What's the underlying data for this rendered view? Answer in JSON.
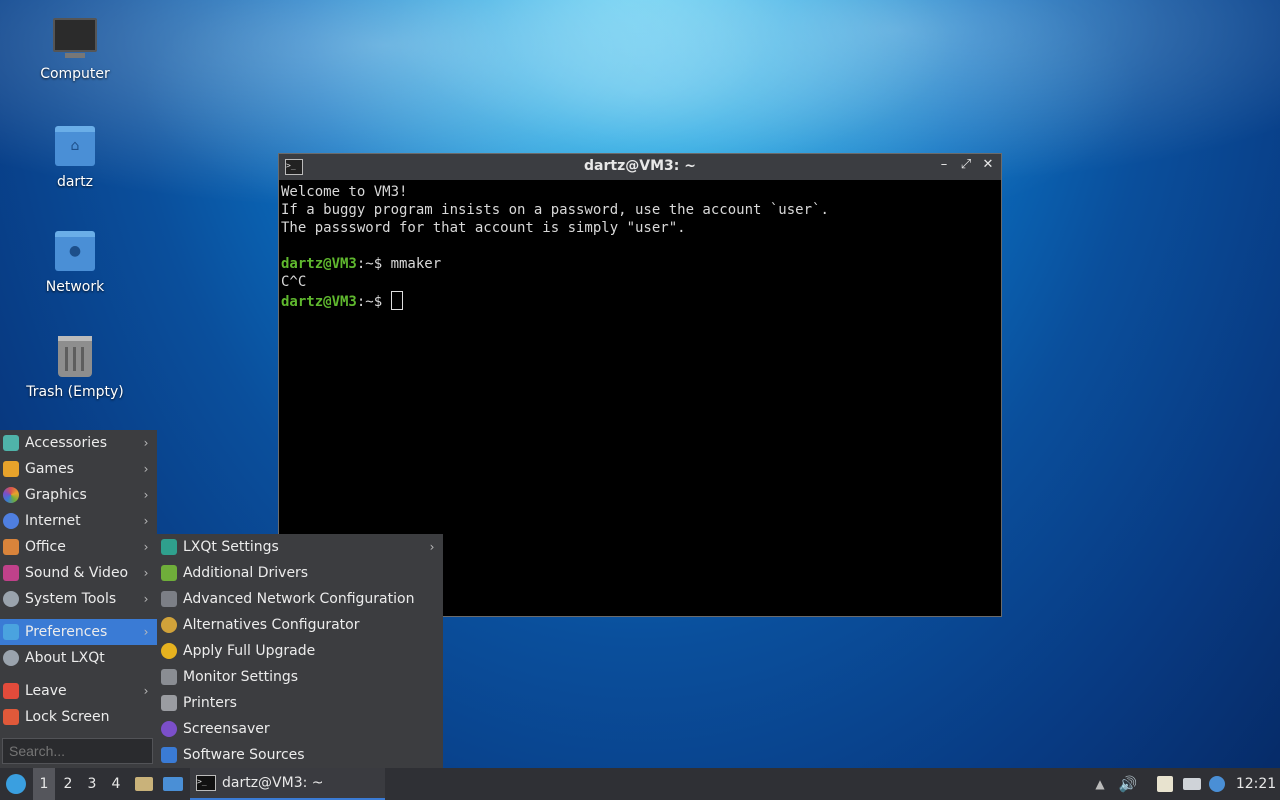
{
  "desktop": {
    "icons": [
      {
        "label": "Computer"
      },
      {
        "label": "dartz"
      },
      {
        "label": "Network"
      },
      {
        "label": "Trash (Empty)"
      }
    ]
  },
  "terminal": {
    "title": "dartz@VM3: ~",
    "lines": {
      "l1": "Welcome to VM3!",
      "l2": "If a buggy program insists on a password, use the account `user`.",
      "l3": "The passsword for that account is simply \"user\".",
      "prompt": "dartz@VM3",
      "cmd1_path": ":~$ ",
      "cmd1": "mmaker",
      "interrupt": "C^C",
      "cmd2_path": ":~$ "
    },
    "controls": {
      "minimize": "–",
      "maximize": "⤢",
      "close": "✕"
    }
  },
  "menu": {
    "items": [
      {
        "label": "Accessories",
        "color": "#4fb3a9"
      },
      {
        "label": "Games",
        "color": "#e8a32b"
      },
      {
        "label": "Graphics",
        "color": "#d9534f"
      },
      {
        "label": "Internet",
        "color": "#4f7fe0"
      },
      {
        "label": "Office",
        "color": "#d9843b"
      },
      {
        "label": "Sound & Video",
        "color": "#c0418a"
      },
      {
        "label": "System Tools",
        "color": "#9aa3ad"
      },
      {
        "label": "Preferences",
        "color": "#4aa3df"
      },
      {
        "label": "About LXQt",
        "color": "#9aa3ad"
      },
      {
        "label": "Leave",
        "color": "#e24b3b"
      },
      {
        "label": "Lock Screen",
        "color": "#e0593a"
      }
    ],
    "search_placeholder": "Search..."
  },
  "submenu": {
    "items": [
      {
        "label": "LXQt Settings",
        "color": "#2fa08d"
      },
      {
        "label": "Additional Drivers",
        "color": "#6fae3a"
      },
      {
        "label": "Advanced Network Configuration",
        "color": "#7c7f86"
      },
      {
        "label": "Alternatives Configurator",
        "color": "#d0a23a"
      },
      {
        "label": "Apply Full Upgrade",
        "color": "#e6b21f"
      },
      {
        "label": "Monitor Settings",
        "color": "#8a8d93"
      },
      {
        "label": "Printers",
        "color": "#9a9ca1"
      },
      {
        "label": "Screensaver",
        "color": "#7b4fc9"
      },
      {
        "label": "Software Sources",
        "color": "#3a7bd5"
      }
    ]
  },
  "taskbar": {
    "workspaces": [
      "1",
      "2",
      "3",
      "4"
    ],
    "active_workspace": "1",
    "task_title": "dartz@VM3: ~",
    "clock": "12:21"
  }
}
